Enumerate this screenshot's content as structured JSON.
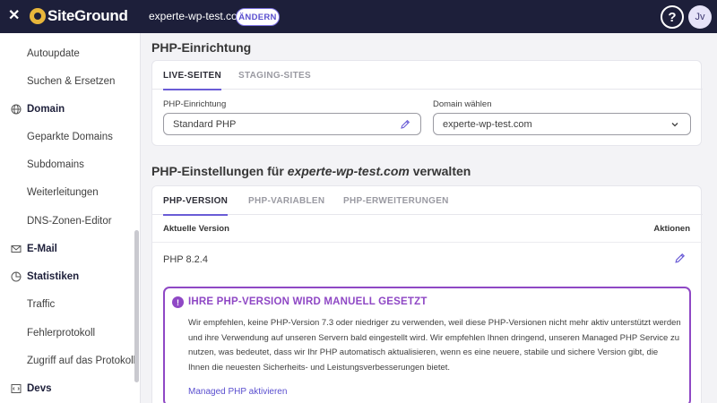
{
  "topbar": {
    "logo_text": "SiteGround",
    "domain": "experte-wp-test.com",
    "change_label": "ÄNDERN",
    "help_label": "?",
    "avatar_initials": "Jv"
  },
  "sidebar": {
    "items": [
      {
        "label": "Autoupdate",
        "type": "item"
      },
      {
        "label": "Suchen & Ersetzen",
        "type": "item"
      },
      {
        "label": "Domain",
        "type": "section",
        "icon": "globe-icon"
      },
      {
        "label": "Geparkte Domains",
        "type": "item"
      },
      {
        "label": "Subdomains",
        "type": "item"
      },
      {
        "label": "Weiterleitungen",
        "type": "item"
      },
      {
        "label": "DNS-Zonen-Editor",
        "type": "item"
      },
      {
        "label": "E-Mail",
        "type": "section",
        "icon": "mail-icon"
      },
      {
        "label": "Statistiken",
        "type": "section",
        "icon": "pie-chart-icon"
      },
      {
        "label": "Traffic",
        "type": "item"
      },
      {
        "label": "Fehlerprotokoll",
        "type": "item"
      },
      {
        "label": "Zugriff auf das Protokoll",
        "type": "item"
      },
      {
        "label": "Devs",
        "type": "section",
        "icon": "code-icon"
      }
    ]
  },
  "setup": {
    "title": "PHP-Einrichtung",
    "tabs": [
      {
        "label": "LIVE-SEITEN",
        "active": true
      },
      {
        "label": "STAGING-SITES",
        "active": false
      }
    ],
    "php_label": "PHP-Einrichtung",
    "php_value": "Standard PHP",
    "domain_label": "Domain wählen",
    "domain_value": "experte-wp-test.com"
  },
  "settings": {
    "title_prefix": "PHP-Einstellungen für ",
    "title_domain": "experte-wp-test.com",
    "title_suffix": " verwalten",
    "tabs": [
      {
        "label": "PHP-VERSION",
        "active": true
      },
      {
        "label": "PHP-VARIABLEN",
        "active": false
      },
      {
        "label": "PHP-ERWEITERUNGEN",
        "active": false
      }
    ],
    "col_version": "Aktuelle Version",
    "col_actions": "Aktionen",
    "current_version": "PHP 8.2.4",
    "alert": {
      "title": "IHRE PHP-VERSION WIRD MANUELL GESETZT",
      "body": "Wir empfehlen, keine PHP-Version 7.3 oder niedriger zu verwenden, weil diese PHP-Versionen nicht mehr aktiv unterstützt werden und ihre Verwendung auf unseren Servern bald eingestellt wird. Wir empfehlen Ihnen dringend, unseren Managed PHP Service zu nutzen, was bedeutet, dass wir Ihr PHP automatisch aktualisieren, wenn es eine neuere, stabile und sichere Version gibt, die Ihnen die neuesten Sicherheits- und Leistungsverbesserungen bietet.",
      "link": "Managed PHP aktivieren"
    }
  },
  "colors": {
    "topbar": "#1d1f3a",
    "accent": "#6a5cd6",
    "alert": "#8f48c5"
  }
}
